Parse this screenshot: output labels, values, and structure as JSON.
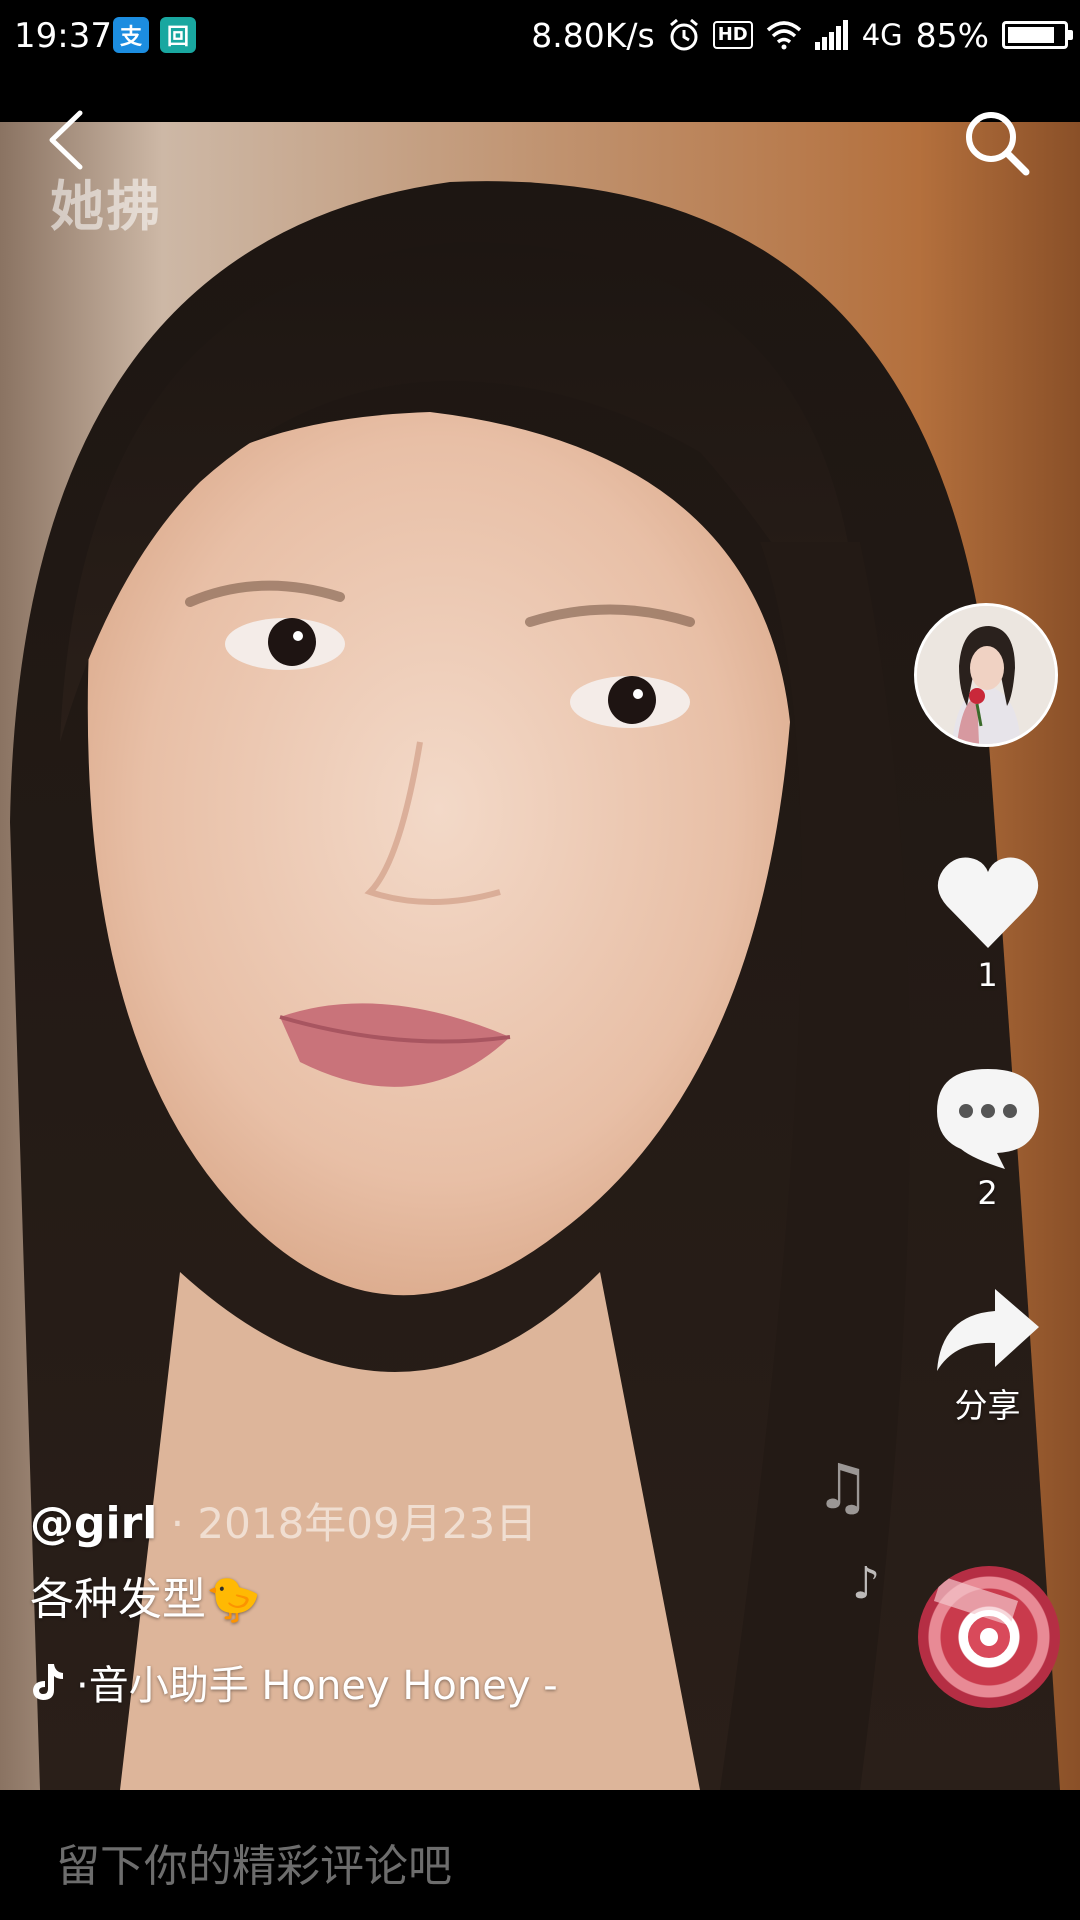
{
  "status_bar": {
    "time": "19:37",
    "alipay_glyph": "支",
    "scan_glyph": "回",
    "network_speed": "8.80K/s",
    "hd_label": "HD",
    "network_type": "4G",
    "battery_percent": "85%",
    "battery_level": 0.85,
    "icons": [
      "alipay-icon",
      "scan-icon",
      "alarm-icon",
      "hd-icon",
      "wifi-icon",
      "signal-icon",
      "battery-icon"
    ]
  },
  "video": {
    "watermark": "她拂"
  },
  "top_bar": {
    "back_icon": "chevron-left-icon",
    "search_icon": "search-icon"
  },
  "right_rail": {
    "like_count": "1",
    "comment_count": "2",
    "share_label": "分享"
  },
  "post": {
    "author": "@girl",
    "date": " · 2018年09月23日",
    "caption": "各种发型",
    "caption_emoji": "🐤",
    "music_text": "·音小助手    Honey Honey -"
  },
  "comment_bar": {
    "placeholder": "留下你的精彩评论吧"
  },
  "colors": {
    "background": "#000000",
    "like_icon": "#f5f5f5",
    "disc_accent": "#d94a5b",
    "placeholder": "#6d6d6d"
  }
}
